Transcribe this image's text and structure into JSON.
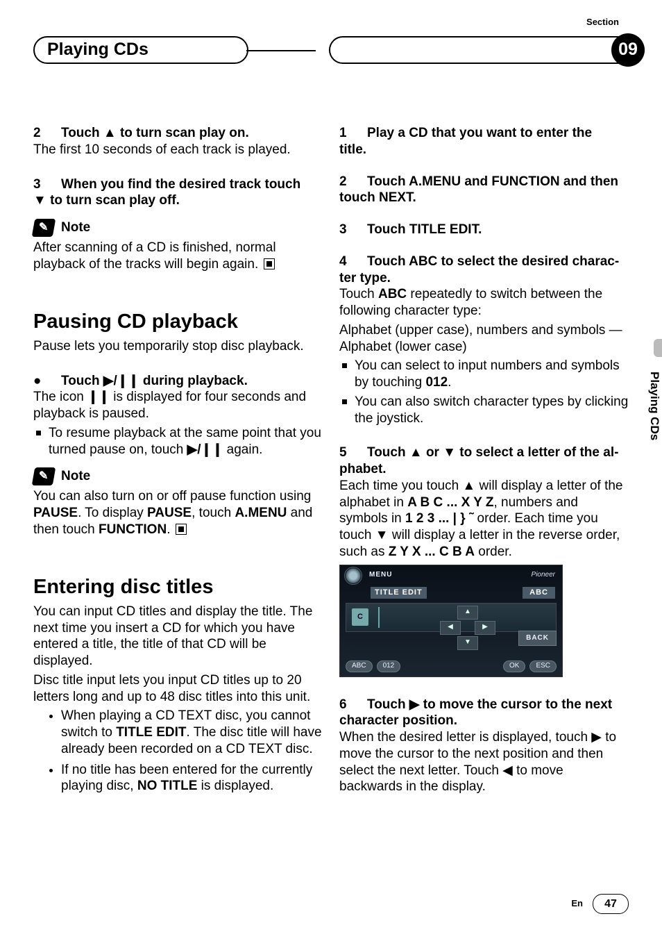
{
  "header": {
    "section_label": "Section",
    "title": "Playing CDs",
    "section_num": "09"
  },
  "side_tab": "Playing CDs",
  "footer": {
    "lang": "En",
    "page": "47"
  },
  "left": {
    "s2": {
      "num": "2",
      "head": "Touch ▲ to turn scan play on.",
      "body": "The first 10 seconds of each track is played."
    },
    "s3": {
      "num": "3",
      "head_a": "When you find the desired track touch",
      "head_b": "▼ to turn scan play off."
    },
    "note1": {
      "label": "Note",
      "text": "After scanning of a CD is finished, normal playback of the tracks will begin again."
    },
    "pause": {
      "h": "Pausing CD playback",
      "intro": "Pause lets you temporarily stop disc playback.",
      "bullet_head": "Touch ▶/❙❙ during playback.",
      "body1a": "The icon ",
      "body1_icon": "❙❙",
      "body1b": " is displayed for four seconds and playback is paused.",
      "sq1a": "To resume playback at the same point that you turned pause on, touch ",
      "sq1b": "▶/❙❙",
      "sq1c": " again."
    },
    "note2": {
      "label": "Note",
      "t1": "You can also turn on or off pause function using ",
      "b1": "PAUSE",
      "t2": ". To display ",
      "b2": "PAUSE",
      "t3": ", touch ",
      "b3": "A.MENU",
      "t4": " and then touch ",
      "b4": "FUNCTION",
      "t5": "."
    },
    "enter": {
      "h": "Entering disc titles",
      "p1": "You can input CD titles and display the title. The next time you insert a CD for which you have entered a title, the title of that CD will be displayed.",
      "p2": "Disc title input lets you input CD titles up to 20 letters long and up to 48 disc titles into this unit.",
      "li1a": "When playing a CD TEXT disc, you cannot switch to ",
      "li1b": "TITLE EDIT",
      "li1c": ". The disc title will have already been recorded on a CD TEXT disc.",
      "li2a": "If no title has been entered for the currently playing disc, ",
      "li2b": "NO TITLE",
      "li2c": " is displayed."
    }
  },
  "right": {
    "s1": {
      "num": "1",
      "head_a": "Play a CD that you want to enter the",
      "head_b": "title."
    },
    "s2": {
      "num": "2",
      "head_a": "Touch A.MENU and FUNCTION and then",
      "head_b": "touch NEXT."
    },
    "s3": {
      "num": "3",
      "head": "Touch TITLE EDIT."
    },
    "s4": {
      "num": "4",
      "head_a": "Touch ABC to select the desired charac-",
      "head_b": "ter type.",
      "body1a": "Touch ",
      "body1b": "ABC",
      "body1c": " repeatedly to switch between the following character type:",
      "body2": "Alphabet (upper case), numbers and symbols —Alphabet (lower case)",
      "sq1a": "You can select to input numbers and symbols by touching ",
      "sq1b": "012",
      "sq1c": ".",
      "sq2": "You can also switch character types by clicking the joystick."
    },
    "s5": {
      "num": "5",
      "head_a": "Touch ▲ or ▼ to select a letter of the al-",
      "head_b": "phabet.",
      "t1": "Each time you touch ▲ will display a letter of the alphabet in ",
      "b1": "A B C ... X Y Z",
      "t2": ", numbers and symbols in ",
      "b2": "1 2 3 ... | } ˜",
      "t3": " order. Each time you touch ▼ will display a letter in the reverse order, such as ",
      "b3": "Z Y X ... C B A",
      "t4": " order."
    },
    "shot": {
      "menu": "MENU",
      "brand": "Pioneer",
      "title_edit": "TITLE EDIT",
      "abc": "ABC",
      "cursor_letter": "C",
      "back": "BACK",
      "pill_abc": "ABC",
      "pill_012": "012",
      "ok": "OK",
      "esc": "ESC"
    },
    "s6": {
      "num": "6",
      "head_a": "Touch ▶ to move the cursor to the next",
      "head_b": "character position.",
      "body": "When the desired letter is displayed, touch ▶ to move the cursor to the next position and then select the next letter. Touch ◀ to move backwards in the display."
    }
  }
}
